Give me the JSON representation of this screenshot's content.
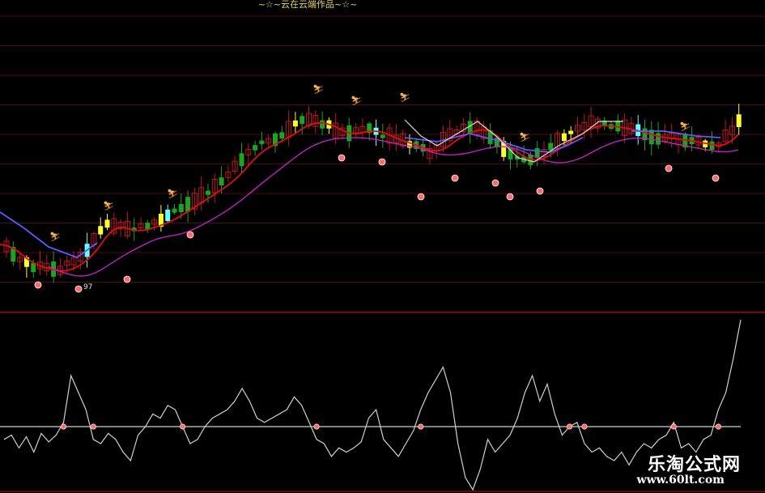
{
  "header": {
    "title": "~☆~云在云端作品~☆~"
  },
  "watermark": {
    "brand": "乐淘公式网",
    "url": "www.60lt.com"
  },
  "colors": {
    "background": "#000000",
    "gridline": "#4a0d1a",
    "separator": "#b0101e",
    "candle_up": "#c0161c",
    "candle_down": "#1ea31e",
    "highlight_yellow": "#ffff33",
    "highlight_cyan": "#66ffff",
    "ma_fast": "#e01010",
    "ma_slow": "#c020c0",
    "trend_blue": "#5a5cff",
    "trend_white": "#d8d8d8",
    "oscillator": "#d0d0d0",
    "baseline": "#d0d0d0",
    "signal_dot": "#ff6a6a",
    "title": "#e8d45a"
  },
  "chart_data": [
    {
      "type": "candlestick",
      "panel": "price",
      "title": "~☆~云在云端作品~☆~",
      "grid": true,
      "low_label": "97",
      "series": [
        {
          "kind": "candles",
          "count": 110
        },
        {
          "kind": "line",
          "name": "",
          "color": "ma_fast"
        },
        {
          "kind": "line",
          "name": "",
          "color": "ma_slow"
        },
        {
          "kind": "line",
          "name": "",
          "color": "trend_blue"
        },
        {
          "kind": "markers",
          "symbol": "red-dot"
        },
        {
          "kind": "markers",
          "symbol": "runner"
        }
      ]
    },
    {
      "type": "line",
      "panel": "oscillator",
      "grid": false,
      "baseline_level": 0,
      "ylim": [
        -100,
        100
      ],
      "values": [
        -15,
        -10,
        -25,
        -12,
        -30,
        -8,
        -18,
        -10,
        5,
        60,
        40,
        20,
        -15,
        -20,
        -8,
        -15,
        -30,
        -40,
        -10,
        0,
        15,
        10,
        25,
        20,
        0,
        -20,
        -15,
        0,
        10,
        15,
        20,
        30,
        45,
        30,
        10,
        5,
        10,
        15,
        20,
        35,
        25,
        5,
        -15,
        -20,
        -35,
        -25,
        -30,
        -25,
        -18,
        10,
        20,
        -15,
        -25,
        -35,
        -20,
        -5,
        20,
        40,
        55,
        70,
        40,
        -20,
        -60,
        -80,
        -50,
        -15,
        -30,
        -20,
        -10,
        10,
        40,
        60,
        30,
        50,
        15,
        -10,
        0,
        5,
        -20,
        -30,
        -25,
        -35,
        -40,
        -30,
        -45,
        -30,
        -20,
        -25,
        -15,
        -10,
        5,
        -25,
        -20,
        -30,
        -15,
        -10,
        20,
        40,
        80,
        150
      ]
    }
  ]
}
